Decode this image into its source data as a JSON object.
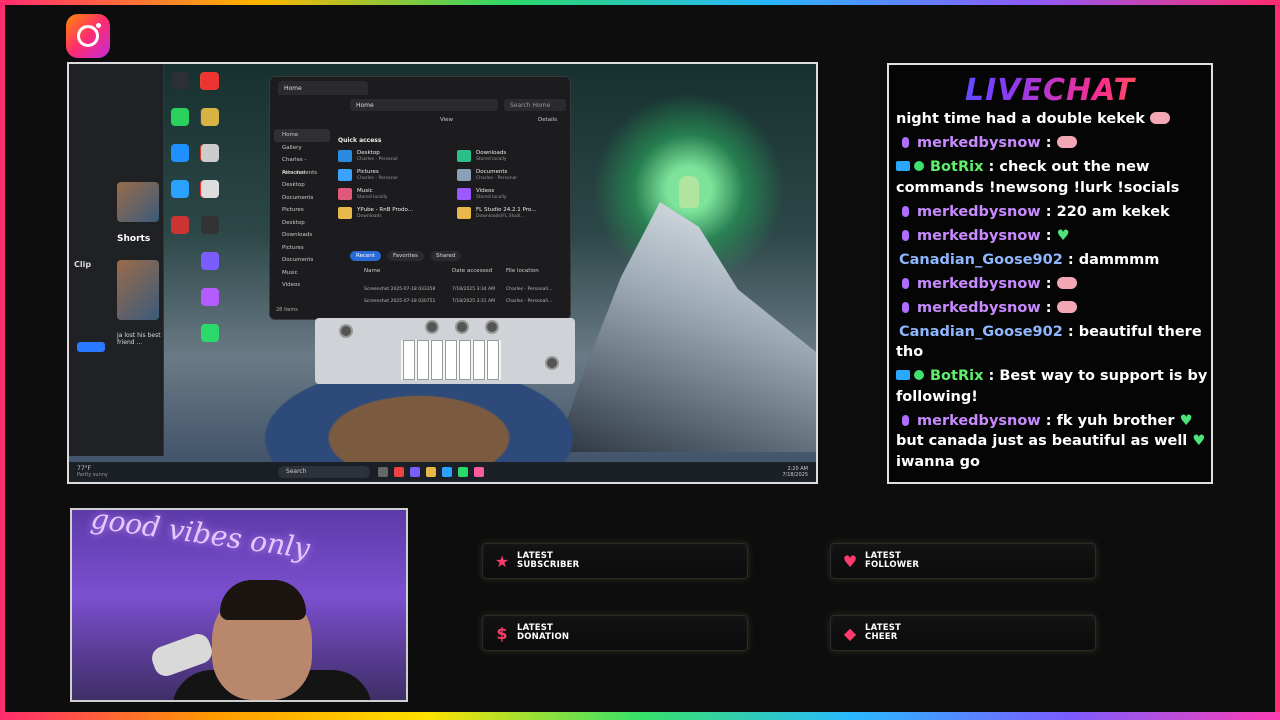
{
  "social": {
    "icon": "instagram-icon"
  },
  "screen": {
    "left_app": {
      "items": [
        "Shorts",
        "Clip"
      ],
      "video_caption": "Ja lost his best friend ..."
    },
    "explorer": {
      "tab_title": "Home",
      "address": "Home",
      "search_placeholder": "Search Home",
      "toolbar_view": "View",
      "details_label": "Details",
      "sidebar": [
        "Home",
        "Gallery",
        "Charles - Personal",
        "Attachments",
        "Desktop",
        "Documents",
        "Pictures",
        "Desktop",
        "Downloads",
        "Pictures",
        "Documents",
        "Music",
        "Videos"
      ],
      "quick_access_title": "Quick access",
      "quick_access": [
        {
          "name": "Desktop",
          "sub": "Charles - Personal"
        },
        {
          "name": "Downloads",
          "sub": "Stored locally"
        },
        {
          "name": "Pictures",
          "sub": "Charles - Personal"
        },
        {
          "name": "Documents",
          "sub": "Charles - Personal"
        },
        {
          "name": "Music",
          "sub": "Stored locally"
        },
        {
          "name": "Videos",
          "sub": "Stored locally"
        },
        {
          "name": "YPube - RnB Prodo...",
          "sub": "Downloads"
        },
        {
          "name": "FL Studio 24.2.1 Pro...",
          "sub": "Downloads\\FL Studi..."
        }
      ],
      "filters": [
        "Recent",
        "Favorites",
        "Shared"
      ],
      "columns": [
        "Name",
        "Date accessed",
        "File location"
      ],
      "rows": [
        {
          "name": "Screenshot 2025-07-18 033358",
          "date": "7/18/2025 3:34 AM",
          "loc": "Charles - Personal\\..."
        },
        {
          "name": "Screenshot 2025-07-18 030751",
          "date": "7/18/2025 3:31 AM",
          "loc": "Charles - Personal\\..."
        }
      ],
      "item_count": "28 items"
    },
    "taskbar": {
      "weather": "77°F",
      "weather_sub": "Partly sunny",
      "search": "Search",
      "time": "2:20 AM",
      "date": "7/18/2025"
    }
  },
  "chat": {
    "title": "LIVECHAT",
    "messages": [
      {
        "type": "text",
        "text": "night time had a double kekek",
        "emote": true
      },
      {
        "type": "user",
        "user": "merkedbysnow",
        "color": "purple",
        "badge": "mic",
        "text": "",
        "emote": true
      },
      {
        "type": "bot",
        "user": "BotRix",
        "text": "check out the new commands !newsong !lurk !socials"
      },
      {
        "type": "user",
        "user": "merkedbysnow",
        "color": "purple",
        "badge": "mic",
        "text": "220 am kekek"
      },
      {
        "type": "user",
        "user": "merkedbysnow",
        "color": "purple",
        "badge": "mic",
        "text": "",
        "heart": true
      },
      {
        "type": "user",
        "user": "Canadian_Goose902",
        "color": "blue",
        "badge": "none",
        "text": "dammmm"
      },
      {
        "type": "user",
        "user": "merkedbysnow",
        "color": "purple",
        "badge": "mic",
        "text": "",
        "emote": true
      },
      {
        "type": "user",
        "user": "merkedbysnow",
        "color": "purple",
        "badge": "mic",
        "text": "",
        "emote": true
      },
      {
        "type": "user",
        "user": "Canadian_Goose902",
        "color": "blue",
        "badge": "none",
        "text": "beautiful there tho"
      },
      {
        "type": "bot",
        "user": "BotRix",
        "text": "Best way to support is by following!"
      },
      {
        "type": "user",
        "user": "merkedbysnow",
        "color": "purple",
        "badge": "mic",
        "text": "fk yuh brother",
        "text2": "but canada just as beautiful as well",
        "text3": "iwanna go"
      }
    ]
  },
  "webcam": {
    "neon_text": "good vibes only"
  },
  "panels": [
    {
      "line1": "LATEST",
      "line2": "SUBSCRIBER",
      "icon": "star-icon",
      "color": "#ff3b6b"
    },
    {
      "line1": "LATEST",
      "line2": "FOLLOWER",
      "icon": "heart-icon",
      "color": "#ff3b6b"
    },
    {
      "line1": "LATEST",
      "line2": "DONATION",
      "icon": "dollar-icon",
      "color": "#ff3b6b"
    },
    {
      "line1": "LATEST",
      "line2": "CHEER",
      "icon": "diamond-icon",
      "color": "#ff3b6b"
    }
  ]
}
